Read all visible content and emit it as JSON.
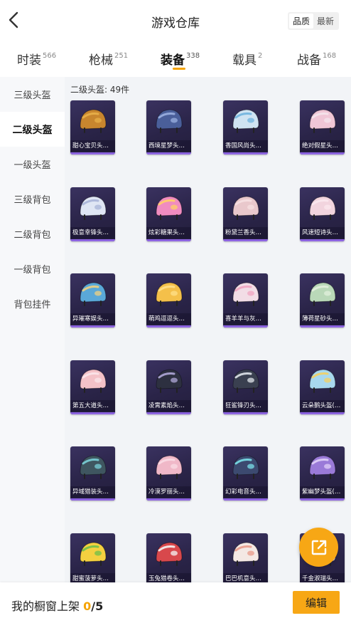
{
  "header": {
    "title": "游戏仓库",
    "sort_options": [
      "品质",
      "最新"
    ],
    "sort_active": "品质"
  },
  "tabs": [
    {
      "label": "时装",
      "count": "566"
    },
    {
      "label": "枪械",
      "count": "251"
    },
    {
      "label": "装备",
      "count": "338",
      "active": true
    },
    {
      "label": "载具",
      "count": "2"
    },
    {
      "label": "战备",
      "count": "168"
    }
  ],
  "sidebar": {
    "items": [
      {
        "label": "三级头盔"
      },
      {
        "label": "二级头盔",
        "active": true
      },
      {
        "label": "一级头盔"
      },
      {
        "label": "三级背包"
      },
      {
        "label": "二级背包"
      },
      {
        "label": "一级背包"
      },
      {
        "label": "背包挂件"
      }
    ]
  },
  "content": {
    "section_title": "二级头盔: 49件",
    "items": [
      {
        "name": "甜心宝贝头盔...",
        "color": "#c8862e",
        "accent": "#e8b04a"
      },
      {
        "name": "西境星梦头盔...",
        "color": "#4a5f9a",
        "accent": "#9bb0e0"
      },
      {
        "name": "香国风尚头盔...",
        "color": "#cfe3f2",
        "accent": "#6fb3de"
      },
      {
        "name": "绝对假星头盔...",
        "color": "#f0c6d6",
        "accent": "#f4e4ec"
      },
      {
        "name": "极意幸锋头盔...",
        "color": "#dfe6f4",
        "accent": "#a8b4d8"
      },
      {
        "name": "炫彩糖果头盔...",
        "color": "#f08cc0",
        "accent": "#ffd166"
      },
      {
        "name": "粉黛兰香头盔...",
        "color": "#e9c8cc",
        "accent": "#f6e0e2"
      },
      {
        "name": "风速短诗头盔...",
        "color": "#f2d4de",
        "accent": "#fbe8ee"
      },
      {
        "name": "异璀寒娱头盔...",
        "color": "#5aa8d8",
        "accent": "#f0d080"
      },
      {
        "name": "萌鸡逗逗头盔...",
        "color": "#f4c04a",
        "accent": "#ffe08a"
      },
      {
        "name": "喜羊羊与灰太...",
        "color": "#f2dde6",
        "accent": "#f0a4c0"
      },
      {
        "name": "薄荷星砂头盔...",
        "color": "#b9d8b8",
        "accent": "#e2f0dc"
      },
      {
        "name": "第五大道头盔...",
        "color": "#f4c2c8",
        "accent": "#fbe6ea"
      },
      {
        "name": "凌霄素焰头盔...",
        "color": "#2d3040",
        "accent": "#b0a8d8"
      },
      {
        "name": "狂鲨锋刃头盔...",
        "color": "#3a4050",
        "accent": "#e0e4ea"
      },
      {
        "name": "云朵鹅头盔(2...",
        "color": "#a8d8ee",
        "accent": "#f4d060"
      },
      {
        "name": "异域猎装头盔...",
        "color": "#3f5660",
        "accent": "#7ad0d8"
      },
      {
        "name": "冷漠罗丽头盔...",
        "color": "#f0b8c8",
        "accent": "#fadce4"
      },
      {
        "name": "幻彩电音头盔...",
        "color": "#3c4a70",
        "accent": "#7ae0e8"
      },
      {
        "name": "紫幽梦头盔(2...",
        "color": "#9a7ad8",
        "accent": "#e0d0f8"
      },
      {
        "name": "甜蜜菠萝头盔...",
        "color": "#f4d040",
        "accent": "#6fbf4a"
      },
      {
        "name": "玉兔猎卷头盔...",
        "color": "#d8484c",
        "accent": "#f4f4f4"
      },
      {
        "name": "巴巴机意头盔...",
        "color": "#f4e8e4",
        "accent": "#e89a8a"
      },
      {
        "name": "千金淑瑞头盔...",
        "color": "#e8d0e4",
        "accent": "#d8c0e8"
      }
    ]
  },
  "footer": {
    "label": "我的橱窗上架 ",
    "count": "0",
    "total": "/5",
    "edit_label": "编辑"
  },
  "colors": {
    "accent": "#f7a715",
    "card_bg": "#2a2448",
    "card_bar": "#8c63e0"
  },
  "icons": {
    "back": "chevron-left-icon",
    "share": "share-external-icon"
  }
}
